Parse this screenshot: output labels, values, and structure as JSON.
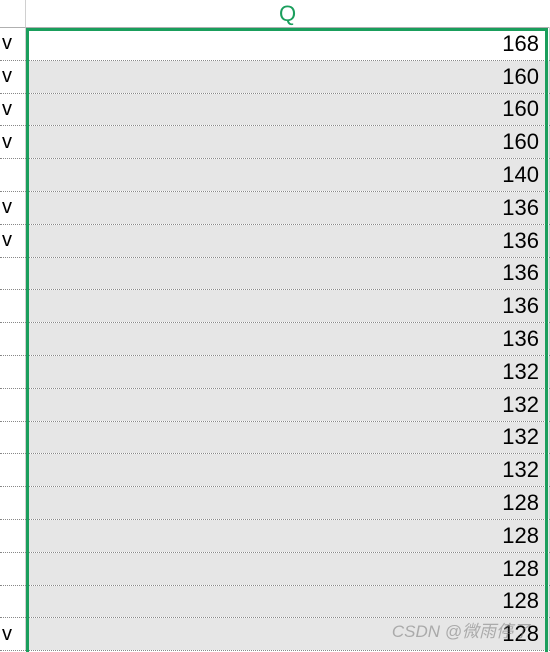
{
  "header": {
    "col_q_label": "Q"
  },
  "rows": [
    {
      "p": "v",
      "q": "168",
      "shaded": false
    },
    {
      "p": "v",
      "q": "160",
      "shaded": true
    },
    {
      "p": "v",
      "q": "160",
      "shaded": true
    },
    {
      "p": "v",
      "q": "160",
      "shaded": true
    },
    {
      "p": "",
      "q": "140",
      "shaded": true
    },
    {
      "p": "v",
      "q": "136",
      "shaded": true
    },
    {
      "p": "v",
      "q": "136",
      "shaded": true
    },
    {
      "p": "",
      "q": "136",
      "shaded": true
    },
    {
      "p": "",
      "q": "136",
      "shaded": true
    },
    {
      "p": "",
      "q": "136",
      "shaded": true
    },
    {
      "p": "",
      "q": "132",
      "shaded": true
    },
    {
      "p": "",
      "q": "132",
      "shaded": true
    },
    {
      "p": "",
      "q": "132",
      "shaded": true
    },
    {
      "p": "",
      "q": "132",
      "shaded": true
    },
    {
      "p": "",
      "q": "128",
      "shaded": true
    },
    {
      "p": "",
      "q": "128",
      "shaded": true
    },
    {
      "p": "",
      "q": "128",
      "shaded": true
    },
    {
      "p": "",
      "q": "128",
      "shaded": true
    },
    {
      "p": "v",
      "q": "128",
      "shaded": true
    }
  ],
  "watermark": "CSDN @微雨停了"
}
